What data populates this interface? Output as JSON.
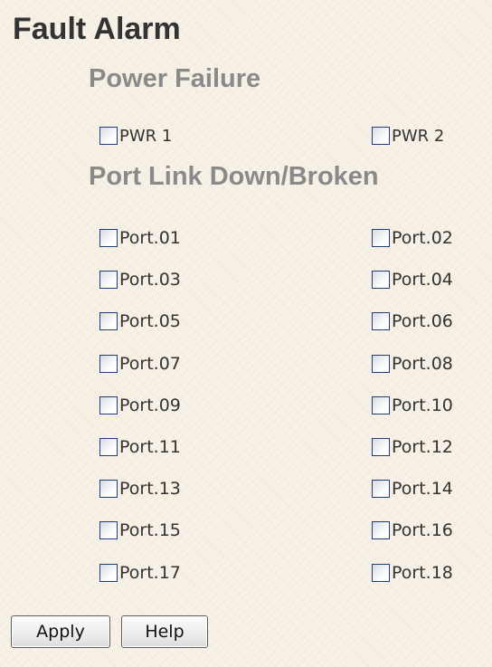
{
  "page": {
    "title": "Fault Alarm"
  },
  "power_failure": {
    "heading": "Power Failure",
    "items": [
      {
        "label": "PWR 1",
        "checked": false
      },
      {
        "label": "PWR 2",
        "checked": false
      }
    ]
  },
  "port_link": {
    "heading": "Port Link Down/Broken",
    "ports": [
      {
        "label": "Port.01",
        "checked": false
      },
      {
        "label": "Port.02",
        "checked": false
      },
      {
        "label": "Port.03",
        "checked": false
      },
      {
        "label": "Port.04",
        "checked": false
      },
      {
        "label": "Port.05",
        "checked": false
      },
      {
        "label": "Port.06",
        "checked": false
      },
      {
        "label": "Port.07",
        "checked": false
      },
      {
        "label": "Port.08",
        "checked": false
      },
      {
        "label": "Port.09",
        "checked": false
      },
      {
        "label": "Port.10",
        "checked": false
      },
      {
        "label": "Port.11",
        "checked": false
      },
      {
        "label": "Port.12",
        "checked": false
      },
      {
        "label": "Port.13",
        "checked": false
      },
      {
        "label": "Port.14",
        "checked": false
      },
      {
        "label": "Port.15",
        "checked": false
      },
      {
        "label": "Port.16",
        "checked": false
      },
      {
        "label": "Port.17",
        "checked": false
      },
      {
        "label": "Port.18",
        "checked": false
      }
    ]
  },
  "buttons": {
    "apply_label": "Apply",
    "help_label": "Help"
  },
  "colors": {
    "background": "#f6efe4",
    "title": "#333333",
    "section_heading": "#8a8a8a",
    "checkbox_border": "#1f3d7a"
  }
}
